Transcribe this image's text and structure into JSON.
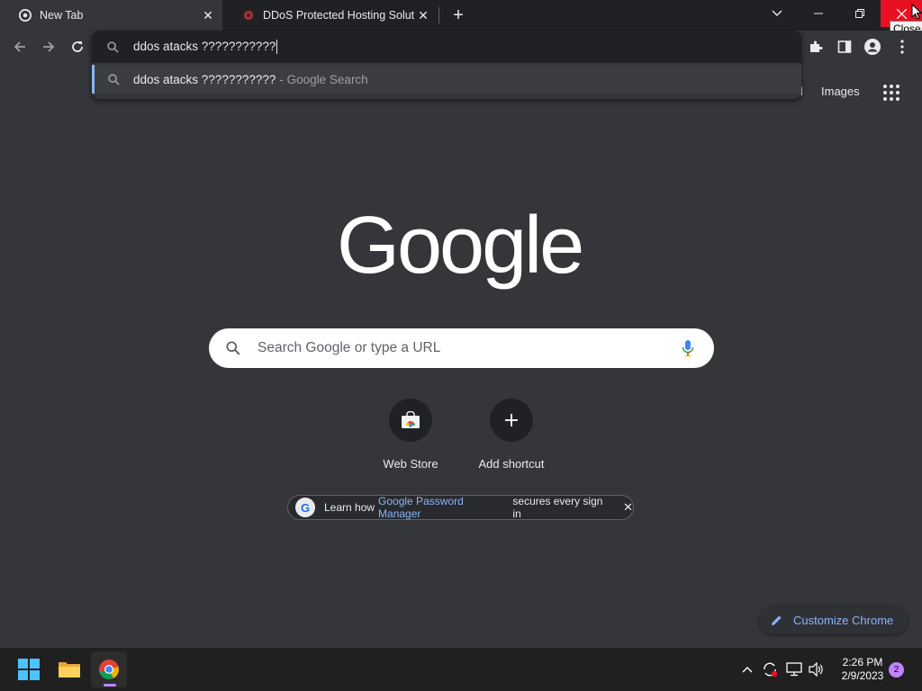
{
  "tabs": [
    {
      "title": "New Tab",
      "icon": "chrome-icon",
      "active": true
    },
    {
      "title": "DDoS Protected Hosting Solution",
      "icon": "ddos-site-favicon",
      "active": false
    }
  ],
  "window": {
    "close_tooltip": "Close"
  },
  "omnibox": {
    "value": "ddos atacks ???????????",
    "suggestion_query": "ddos atacks ???????????",
    "suggestion_source": "- Google Search"
  },
  "ntp": {
    "gmail_link": "il",
    "images_link": "Images",
    "logo": "Google",
    "search_placeholder": "Search Google or type a URL",
    "shortcuts": [
      {
        "label": "Web Store",
        "icon": "web-store-icon"
      },
      {
        "label": "Add shortcut",
        "icon": "plus-icon"
      }
    ],
    "promo": {
      "prefix": "Learn how",
      "link": "Google Password Manager",
      "suffix": "secures every sign in"
    },
    "customize_label": "Customize Chrome"
  },
  "taskbar": {
    "time": "2:26 PM",
    "date": "2/9/2023",
    "notification_count": "2"
  },
  "colors": {
    "accent": "#8ab4f8",
    "close_red": "#e81123",
    "indicator": "#c084fc"
  }
}
